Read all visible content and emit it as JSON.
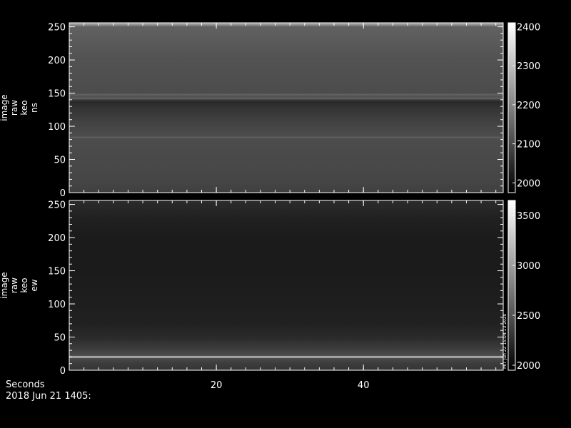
{
  "chart_data": [
    {
      "type": "heatmap",
      "ylabel": [
        "image",
        "raw",
        "keo",
        "ns"
      ],
      "xlim": [
        0,
        59
      ],
      "ylim": [
        0,
        256
      ],
      "yticks": [
        0,
        50,
        100,
        150,
        200,
        250
      ],
      "xticks": [
        20,
        40
      ],
      "xtick_labels_shown": false,
      "colorbar": {
        "range": [
          1975,
          2410
        ],
        "ticks": [
          2000,
          2100,
          2200,
          2300,
          2400
        ]
      },
      "profile": [
        {
          "y": 0,
          "v": 2085
        },
        {
          "y": 20,
          "v": 2095
        },
        {
          "y": 50,
          "v": 2100
        },
        {
          "y": 82,
          "v": 2105
        },
        {
          "y": 83,
          "v": 2150
        },
        {
          "y": 85,
          "v": 2105
        },
        {
          "y": 110,
          "v": 2085
        },
        {
          "y": 125,
          "v": 2065
        },
        {
          "y": 137,
          "v": 2045
        },
        {
          "y": 140,
          "v": 2080
        },
        {
          "y": 142,
          "v": 2150
        },
        {
          "y": 144,
          "v": 2110
        },
        {
          "y": 148,
          "v": 2140
        },
        {
          "y": 150,
          "v": 2105
        },
        {
          "y": 200,
          "v": 2115
        },
        {
          "y": 250,
          "v": 2140
        },
        {
          "y": 254,
          "v": 2250
        },
        {
          "y": 256,
          "v": 2200
        }
      ]
    },
    {
      "type": "heatmap",
      "ylabel": [
        "image",
        "raw",
        "keo",
        "ew"
      ],
      "xlim": [
        0,
        59
      ],
      "ylim": [
        0,
        256
      ],
      "yticks": [
        0,
        50,
        100,
        150,
        200,
        250
      ],
      "xticks": [
        20,
        40
      ],
      "xtick_labels_shown": true,
      "colorbar": {
        "range": [
          1950,
          3650
        ],
        "ticks": [
          2000,
          2500,
          3000,
          3500
        ]
      },
      "profile": [
        {
          "y": 0,
          "v": 2300
        },
        {
          "y": 10,
          "v": 2350
        },
        {
          "y": 18,
          "v": 2450
        },
        {
          "y": 20,
          "v": 3400
        },
        {
          "y": 22,
          "v": 2450
        },
        {
          "y": 35,
          "v": 2330
        },
        {
          "y": 50,
          "v": 2230
        },
        {
          "y": 70,
          "v": 2170
        },
        {
          "y": 100,
          "v": 2150
        },
        {
          "y": 150,
          "v": 2130
        },
        {
          "y": 200,
          "v": 2130
        },
        {
          "y": 230,
          "v": 2170
        },
        {
          "y": 256,
          "v": 2240
        }
      ],
      "side_annotation": "MIT Jun 22 15:04:13 2020"
    }
  ],
  "footer": {
    "x_axis_label": "Seconds",
    "date_label": "2018 Jun 21 1405:"
  }
}
